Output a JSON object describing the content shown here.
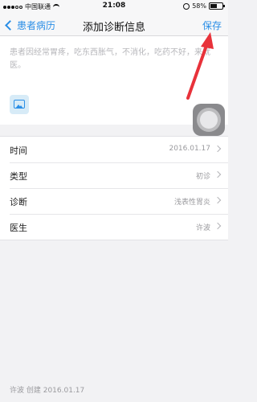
{
  "status_bar": {
    "carrier": "中国联通",
    "time": "21:08",
    "battery_percent": "58%",
    "battery_level": 0.58
  },
  "nav": {
    "back_label": "患者病历",
    "title": "添加诊断信息",
    "save_label": "保存"
  },
  "note": {
    "placeholder": "患者因经常胃疼，吃东西胀气，不消化，吃药不好，来就医。"
  },
  "form": {
    "rows": [
      {
        "label": "时间",
        "value": "2016.01.17"
      },
      {
        "label": "类型",
        "value": "初诊"
      },
      {
        "label": "诊断",
        "value": "浅表性胃炎"
      },
      {
        "label": "医生",
        "value": "许波"
      }
    ]
  },
  "footer": {
    "created": "许波 创建 2016.01.17"
  },
  "colors": {
    "accent": "#2a8ee6",
    "annotation_arrow": "#e8323a"
  }
}
